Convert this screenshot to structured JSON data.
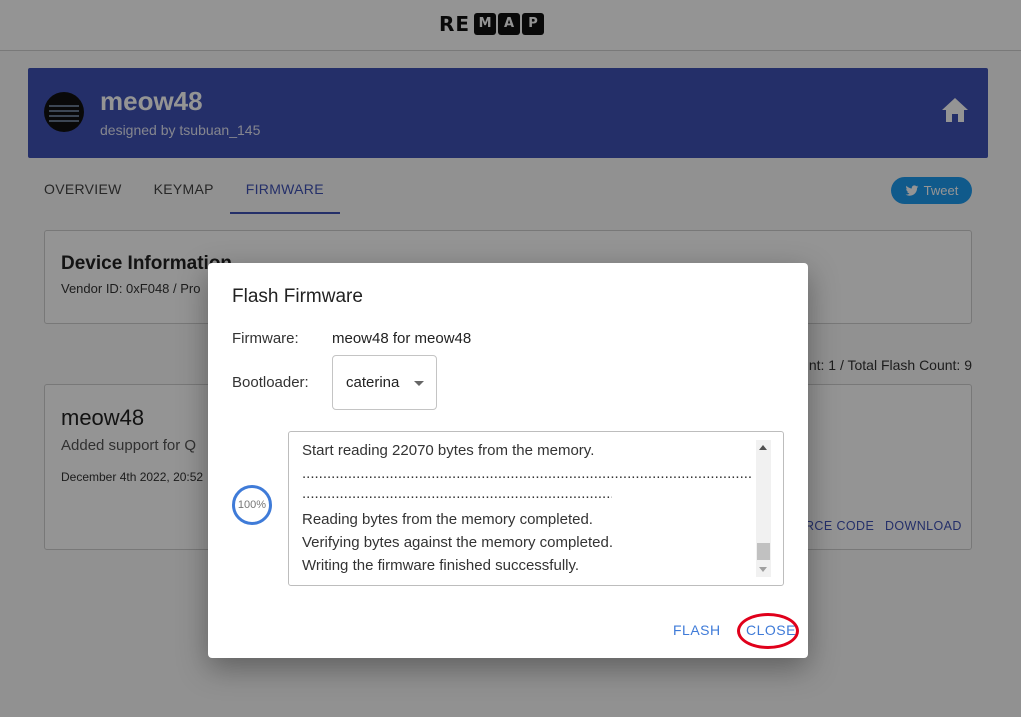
{
  "app": {
    "logo_re": "RE",
    "logo_letters": [
      "M",
      "A",
      "P"
    ]
  },
  "keyboard": {
    "name": "meow48",
    "designer": "designed by tsubuan_145"
  },
  "tabs": [
    {
      "label": "OVERVIEW",
      "active": false
    },
    {
      "label": "KEYMAP",
      "active": false
    },
    {
      "label": "FIRMWARE",
      "active": true
    }
  ],
  "tweet": {
    "label": "Tweet"
  },
  "device_info": {
    "title": "Device Information",
    "vendor": "Vendor ID: 0xF048 / Pro"
  },
  "flash_count": "nt: 1 / Total Flash Count: 9",
  "firmware_card": {
    "name": "meow48",
    "description": "Added support for Q",
    "date": "December 4th 2022, 20:52",
    "source_code": "RCE CODE",
    "download": "DOWNLOAD"
  },
  "dialog": {
    "title": "Flash Firmware",
    "firmware_label": "Firmware:",
    "firmware_value": "meow48 for meow48",
    "bootloader_label": "Bootloader:",
    "bootloader_value": "caterina",
    "progress": "100%",
    "log": {
      "line1": "Start reading 22070 bytes from the memory.",
      "dots1": "................................................................................................................",
      "dots2": "...............................................................................",
      "line2": "Reading bytes from the memory completed.",
      "line3": "Verifying bytes against the memory completed.",
      "line4": "Writing the firmware finished successfully."
    },
    "flash_button": "FLASH",
    "close_button": "CLOSE"
  },
  "colors": {
    "header_bg": "#3f51b5",
    "accent": "#3f7bd8",
    "annotation": "#e0001b",
    "tweet": "#1d9bf0"
  }
}
